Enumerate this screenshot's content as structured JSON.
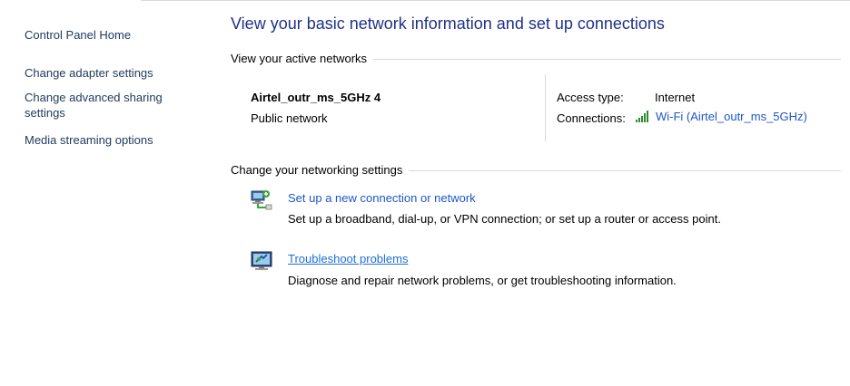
{
  "sidebar": {
    "home": "Control Panel Home",
    "items": [
      {
        "label": "Change adapter settings"
      },
      {
        "label": "Change advanced sharing settings"
      },
      {
        "label": "Media streaming options"
      }
    ]
  },
  "main": {
    "title": "View your basic network information and set up connections",
    "active_section": "View your active networks",
    "network": {
      "name": "Airtel_outr_ms_5GHz 4",
      "category": "Public network",
      "access_label": "Access type:",
      "access_value": "Internet",
      "connections_label": "Connections:",
      "connection_link": "Wi-Fi (Airtel_outr_ms_5GHz)",
      "connection_icon": "wifi-signal-icon"
    },
    "change_section": "Change your networking settings",
    "tasks": [
      {
        "title": "Set up a new connection or network",
        "description": "Set up a broadband, dial-up, or VPN connection; or set up a router or access point.",
        "icon": "new-connection-icon"
      },
      {
        "title": "Troubleshoot problems",
        "description": "Diagnose and repair network problems, or get troubleshooting information.",
        "icon": "troubleshoot-icon"
      }
    ]
  },
  "colors": {
    "title": "#1e3287",
    "link": "#1e56c8",
    "sidebar_link": "#1e395b",
    "signal": "#2e8b2e"
  }
}
